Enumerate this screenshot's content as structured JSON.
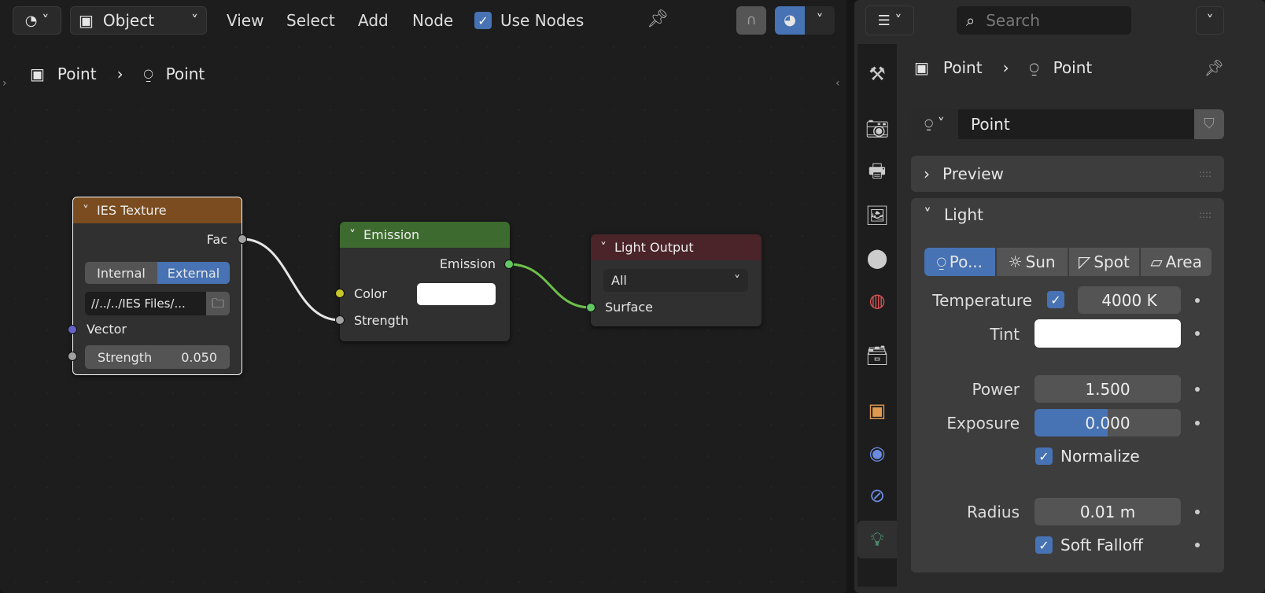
{
  "header": {
    "editor_type_icon": "shader-editor-icon",
    "mode": "Object",
    "menus": [
      "View",
      "Select",
      "Add",
      "Node"
    ],
    "use_nodes_label": "Use Nodes",
    "use_nodes": true
  },
  "breadcrumb": {
    "object": "Point",
    "light": "Point"
  },
  "nodes": {
    "ies": {
      "title": "IES Texture",
      "color": "#7a4c1f",
      "output": "Fac",
      "mode_internal": "Internal",
      "mode_external": "External",
      "mode_selected": "External",
      "filepath": "//../../IES Files/...",
      "vector": "Vector",
      "strength_label": "Strength",
      "strength_value": "0.050"
    },
    "emission": {
      "title": "Emission",
      "color": "#3d6b2f",
      "output": "Emission",
      "color_label": "Color",
      "strength_label": "Strength",
      "color_value": "#ffffff"
    },
    "output": {
      "title": "Light Output",
      "color": "#4a2428",
      "target": "All",
      "surface": "Surface"
    }
  },
  "properties": {
    "search_placeholder": "Search",
    "breadcrumb": {
      "object": "Point",
      "light": "Point"
    },
    "datablock_name": "Point",
    "preview_label": "Preview",
    "light_label": "Light",
    "light_types": [
      "Po...",
      "Sun",
      "Spot",
      "Area"
    ],
    "light_type_selected": "Po...",
    "temperature_label": "Temperature",
    "use_temperature": true,
    "temperature_value": "4000 K",
    "tint_label": "Tint",
    "tint_color": "#ffffff",
    "power_label": "Power",
    "power_value": "1.500",
    "exposure_label": "Exposure",
    "exposure_value": "0.000",
    "exposure_fill": 0.5,
    "normalize_label": "Normalize",
    "normalize": true,
    "radius_label": "Radius",
    "radius_value": "0.01 m",
    "soft_falloff_label": "Soft Falloff",
    "soft_falloff": true,
    "tabs": [
      "tool-icon",
      "render-icon",
      "output-icon",
      "view-layer-icon",
      "scene-icon",
      "world-icon",
      "collection-icon",
      "object-icon",
      "physics-icon",
      "constraints-icon",
      "light-data-icon"
    ],
    "accent": "#4772b3"
  }
}
